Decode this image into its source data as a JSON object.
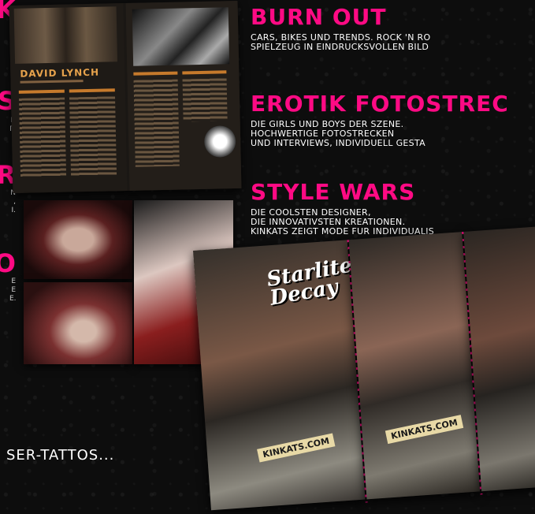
{
  "sections": [
    {
      "heading": "BURN OUT",
      "lines": [
        "CARS, BIKES UND TRENDS. ROCK 'N RO",
        "SPIELZEUG IN EINDRUCKSVOLLEN BILD"
      ]
    },
    {
      "heading": "EROTIK FOTOSTREC",
      "lines": [
        "DIE GIRLS UND BOYS DER SZENE.",
        "HOCHWERTIGE FOTOSTRECKEN",
        "UND INTERVIEWS, INDIVIDUELL GESTA"
      ]
    },
    {
      "heading": "STYLE WARS",
      "lines": [
        "DIE COOLSTEN DESIGNER,",
        "DIE INNOVATIVSTEN KREATIONEN.",
        "KINKATS ZEIGT MODE FÜR INDIVIDUALIS"
      ]
    }
  ],
  "spread": {
    "article_title": "DAVID LYNCH"
  },
  "posters": {
    "title": "Starlite Decay",
    "brand_a": "KINKATS.COM",
    "brand_b": "KINKATS.COM"
  },
  "bottom_caption": "SER-TATTOS...",
  "colors": {
    "accent": "#ff0a84",
    "background": "#0d0d0d"
  }
}
